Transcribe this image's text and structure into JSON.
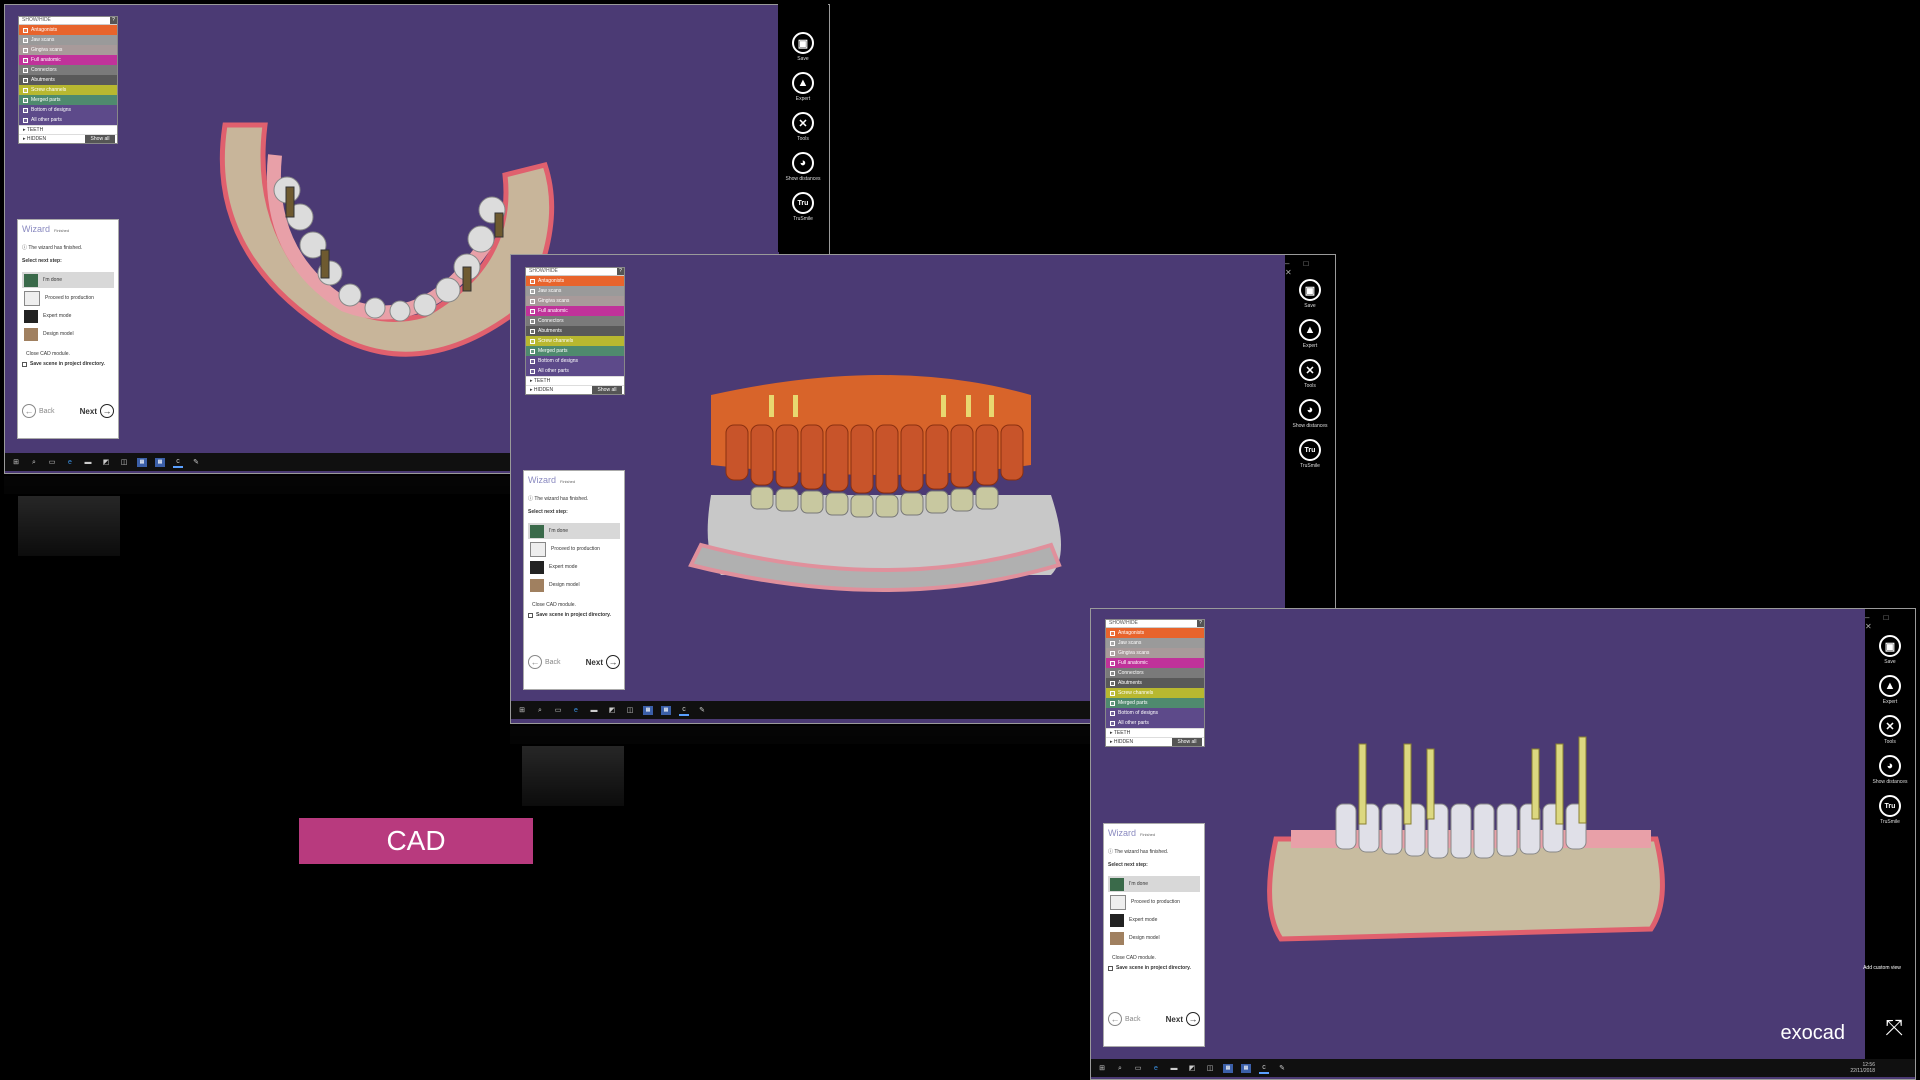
{
  "layers": {
    "header": "SHOW/HIDE",
    "help": "?",
    "items": [
      {
        "label": "Antagonists",
        "color": "#e8642c",
        "checked": true
      },
      {
        "label": "Jaw scans",
        "color": "#9a9a9a",
        "checked": true
      },
      {
        "label": "Gingiva scans",
        "color": "#a89a9a",
        "checked": true
      },
      {
        "label": "Full anatomic",
        "color": "#c0329a",
        "checked": true
      },
      {
        "label": "Connectors",
        "color": "#7a7a7a",
        "checked": false
      },
      {
        "label": "Abutments",
        "color": "#595959",
        "checked": false
      },
      {
        "label": "Screw channels",
        "color": "#b8b830",
        "checked": true
      },
      {
        "label": "Merged parts",
        "color": "#4f8a6e",
        "checked": false
      },
      {
        "label": "Bottom of designs",
        "color": "#5d4a8a",
        "checked": false
      },
      {
        "label": "All other parts",
        "color": "#5d4a8a",
        "checked": false
      }
    ],
    "teeth": "TEETH",
    "hidden": "HIDDEN",
    "show_all": "Show all"
  },
  "wizard": {
    "title": "Wizard",
    "status": "Finished",
    "info": "The wizard has finished.",
    "select": "Select next step:",
    "options": [
      "I'm done",
      "Proceed to production",
      "Expert mode",
      "Design model"
    ],
    "close": "Close CAD module.",
    "save_scene": "Save scene in project directory.",
    "back": "Back",
    "next": "Next"
  },
  "tools": [
    {
      "label": "Save",
      "icon": "save-icon",
      "glyph": "▣"
    },
    {
      "label": "Expert",
      "icon": "expert-icon",
      "glyph": "🎓"
    },
    {
      "label": "Tools",
      "icon": "tools-icon",
      "glyph": "✕"
    },
    {
      "label": "Show distances",
      "icon": "distances-icon",
      "glyph": "◕"
    },
    {
      "label": "TruSmile",
      "icon": "trusmile-icon",
      "glyph": "Tru"
    }
  ],
  "badge": "CAD",
  "brand": "exocad",
  "add_custom_view": "Add custom view",
  "clock": {
    "time": "12:56",
    "date": "22/11/2018"
  },
  "colors": {
    "viewport": "#4b3a74",
    "cad": "#b83a7e"
  }
}
